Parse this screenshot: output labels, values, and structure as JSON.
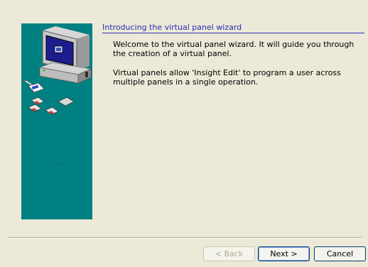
{
  "wizard": {
    "heading": "Introducing the virtual panel wizard",
    "paragraphs": [
      "Welcome to the virtual panel wizard. It will guide you through the creation of a virtual panel.",
      "Virtual panels allow 'Insight Edit' to program a user across multiple panels in a single operation."
    ]
  },
  "buttons": {
    "back": "< Back",
    "next": "Next >",
    "cancel": "Cancel"
  },
  "colors": {
    "dialog_background": "#ece9d8",
    "side_panel": "#008080",
    "heading_text": "#2b2bb8"
  },
  "icons": {
    "side_panel_art": "computer-with-cards-illustration"
  }
}
